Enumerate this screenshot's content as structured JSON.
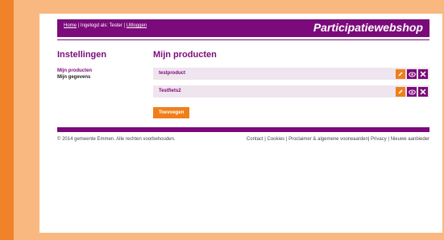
{
  "header": {
    "home_link": "Home",
    "sep1": " | ",
    "logged_in_text": "Ingelogd als: Tester",
    "sep2": " | ",
    "logout_link": "Uitloggen",
    "site_title": "Participatiewebshop"
  },
  "sidebar": {
    "title": "Instellingen",
    "items": [
      {
        "label": "Mijn producten"
      },
      {
        "label": "Mijn gegevens"
      }
    ]
  },
  "main": {
    "title": "Mijn producten",
    "products": [
      {
        "name": "testproduct"
      },
      {
        "name": "Testfiets2"
      }
    ],
    "add_button": "Toevoegen"
  },
  "footer": {
    "copyright": "© 2014 gemeente Emmen. Alle rechten voorbehouden.",
    "links": [
      {
        "label": "Contact"
      },
      {
        "label": "Cookies"
      },
      {
        "label": "Proclaimer & algemene voorwaarden"
      },
      {
        "label": "Privacy"
      },
      {
        "label": "Nieuwe aanbieder"
      }
    ]
  },
  "colors": {
    "brand_purple": "#7b0a7a",
    "accent_orange": "#f07f1a",
    "row_bg": "#efe5ef"
  }
}
